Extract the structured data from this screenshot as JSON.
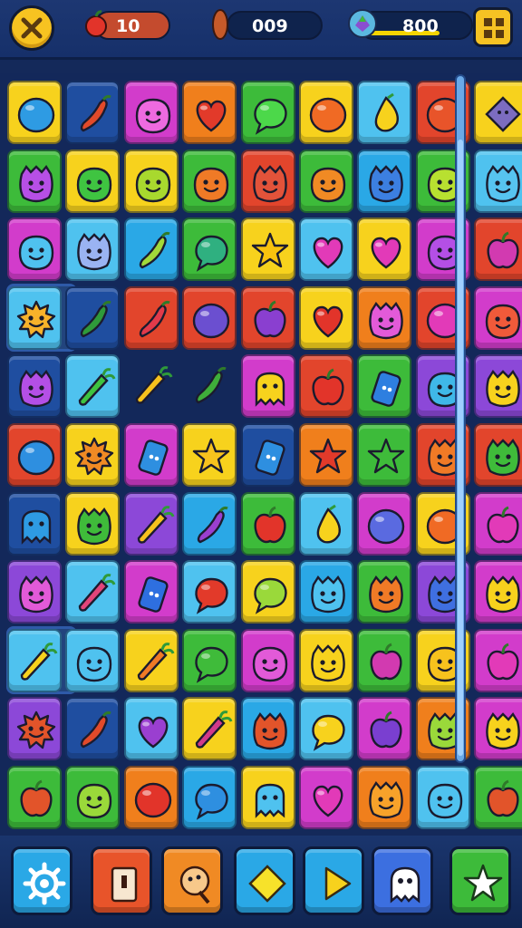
{
  "hud": {
    "moves_value": "10",
    "coins_value": "009",
    "score_value": "800",
    "score_progress": 0.72,
    "moves_icon": "apple-icon",
    "coins_icon": "bean-icon",
    "score_icon": "gem-icon",
    "close_icon": "close-icon",
    "menu_icon": "grid-menu-icon"
  },
  "palette": {
    "yellow": "#f7d21d",
    "blue": "#2aa8e6",
    "magenta": "#d23ccb",
    "orange": "#f07f1c",
    "green": "#3dbb3a",
    "red": "#e2452c",
    "purple": "#8c48d8",
    "lightblue": "#4fc2ef",
    "darkblue": "#1f4ea0"
  },
  "board": {
    "rows": [
      [
        {
          "bg": "yellow",
          "icon": "blob",
          "c": "#2e9be3"
        },
        {
          "bg": "darkblue",
          "icon": "chili",
          "c": "#e24a2a"
        },
        {
          "bg": "magenta",
          "icon": "face",
          "c": "#ee6ae0"
        },
        {
          "bg": "orange",
          "icon": "heart",
          "c": "#e23a2a"
        },
        {
          "bg": "green",
          "icon": "bubble",
          "c": "#4cd84a"
        },
        {
          "bg": "yellow",
          "icon": "blob",
          "c": "#f06a24"
        },
        {
          "bg": "lightblue",
          "icon": "drop",
          "c": "#f7d21d"
        },
        {
          "bg": "red",
          "icon": "blob",
          "c": "#e8542a"
        },
        {
          "bg": "yellow",
          "icon": "diamond",
          "c": "#7c6cc0"
        }
      ],
      [
        {
          "bg": "green",
          "icon": "monster",
          "c": "#b74fe6"
        },
        {
          "bg": "yellow",
          "icon": "face",
          "c": "#3fc441"
        },
        {
          "bg": "yellow",
          "icon": "face",
          "c": "#a8d92e"
        },
        {
          "bg": "green",
          "icon": "face",
          "c": "#f07a26"
        },
        {
          "bg": "red",
          "icon": "monster",
          "c": "#e2533a"
        },
        {
          "bg": "green",
          "icon": "face",
          "c": "#f08a24"
        },
        {
          "bg": "blue",
          "icon": "monster",
          "c": "#3c7fe0"
        },
        {
          "bg": "green",
          "icon": "face",
          "c": "#b8e030"
        },
        {
          "bg": "lightblue",
          "icon": "monster",
          "c": "#57c4f0"
        }
      ],
      [
        {
          "bg": "magenta",
          "icon": "face",
          "c": "#4fc2ef"
        },
        {
          "bg": "lightblue",
          "icon": "monster",
          "c": "#9ab3f2"
        },
        {
          "bg": "blue",
          "icon": "chili",
          "c": "#a2d93a"
        },
        {
          "bg": "green",
          "icon": "bubble",
          "c": "#2fb080"
        },
        {
          "bg": "yellow",
          "icon": "star",
          "c": "#f8c20e"
        },
        {
          "bg": "lightblue",
          "icon": "heart",
          "c": "#e23ab8"
        },
        {
          "bg": "yellow",
          "icon": "heart",
          "c": "#e23ab8"
        },
        {
          "bg": "magenta",
          "icon": "face",
          "c": "#b44fe6"
        },
        {
          "bg": "red",
          "icon": "apple",
          "c": "#d23ab0"
        }
      ],
      [
        {
          "bg": "lightblue",
          "icon": "sun",
          "c": "#f7b22a",
          "selected": true
        },
        {
          "bg": "darkblue",
          "icon": "chili",
          "c": "#2f9a3a"
        },
        {
          "bg": "red",
          "icon": "chili",
          "c": "#e23a4a"
        },
        {
          "bg": "red",
          "icon": "blob",
          "c": "#6b4fd0"
        },
        {
          "bg": "red",
          "icon": "apple",
          "c": "#8a3fd0"
        },
        {
          "bg": "yellow",
          "icon": "heart",
          "c": "#e2342a"
        },
        {
          "bg": "orange",
          "icon": "monster",
          "c": "#e25ad8"
        },
        {
          "bg": "red",
          "icon": "blob",
          "c": "#e23ab8"
        },
        {
          "bg": "magenta",
          "icon": "face",
          "c": "#f05a3a"
        }
      ],
      [
        {
          "bg": "darkblue",
          "icon": "monster",
          "c": "#b44fe6"
        },
        {
          "bg": "lightblue",
          "icon": "carrot",
          "c": "#3fc441"
        },
        {
          "bg": "empty",
          "icon": "carrot",
          "c": "#f7c21d"
        },
        {
          "bg": "empty",
          "icon": "chili",
          "c": "#3fae3a"
        },
        {
          "bg": "magenta",
          "icon": "ghost",
          "c": "#f7d21d"
        },
        {
          "bg": "red",
          "icon": "apple",
          "c": "#e2342a"
        },
        {
          "bg": "green",
          "icon": "phone",
          "c": "#2e7fe0"
        },
        {
          "bg": "purple",
          "icon": "face",
          "c": "#3fb8e8"
        },
        {
          "bg": "purple",
          "icon": "monster",
          "c": "#f7d21d"
        }
      ],
      [
        {
          "bg": "red",
          "icon": "blob",
          "c": "#2e8fe0"
        },
        {
          "bg": "yellow",
          "icon": "sun",
          "c": "#f08a24"
        },
        {
          "bg": "magenta",
          "icon": "phone",
          "c": "#2e8fe0"
        },
        {
          "bg": "yellow",
          "icon": "star",
          "c": "#f7c21d"
        },
        {
          "bg": "darkblue",
          "icon": "phone",
          "c": "#2e8fe0"
        },
        {
          "bg": "orange",
          "icon": "star",
          "c": "#e23a2a"
        },
        {
          "bg": "green",
          "icon": "star",
          "c": "#3fbb3a"
        },
        {
          "bg": "red",
          "icon": "monster",
          "c": "#f07a26"
        },
        {
          "bg": "red",
          "icon": "monster",
          "c": "#3fbb3a"
        }
      ],
      [
        {
          "bg": "darkblue",
          "icon": "ghost",
          "c": "#2e9be3"
        },
        {
          "bg": "yellow",
          "icon": "monster",
          "c": "#3fbb3a"
        },
        {
          "bg": "purple",
          "icon": "carrot",
          "c": "#f7c21d"
        },
        {
          "bg": "blue",
          "icon": "chili",
          "c": "#9a3fd0"
        },
        {
          "bg": "green",
          "icon": "apple",
          "c": "#e2342a"
        },
        {
          "bg": "lightblue",
          "icon": "drop",
          "c": "#f7d21d"
        },
        {
          "bg": "magenta",
          "icon": "blob",
          "c": "#5a6ae0"
        },
        {
          "bg": "yellow",
          "icon": "blob",
          "c": "#f06a24"
        },
        {
          "bg": "magenta",
          "icon": "apple",
          "c": "#e23ab8"
        }
      ],
      [
        {
          "bg": "purple",
          "icon": "monster",
          "c": "#e25ad8"
        },
        {
          "bg": "lightblue",
          "icon": "carrot",
          "c": "#e2457a"
        },
        {
          "bg": "magenta",
          "icon": "phone",
          "c": "#2e6fe0"
        },
        {
          "bg": "lightblue",
          "icon": "bubble",
          "c": "#e23a2a"
        },
        {
          "bg": "yellow",
          "icon": "bubble",
          "c": "#9ad93a"
        },
        {
          "bg": "blue",
          "icon": "monster",
          "c": "#4fc2ef"
        },
        {
          "bg": "green",
          "icon": "monster",
          "c": "#f07a26"
        },
        {
          "bg": "purple",
          "icon": "monster",
          "c": "#3f6fe0"
        },
        {
          "bg": "magenta",
          "icon": "monster",
          "c": "#f7d21d"
        }
      ],
      [
        {
          "bg": "lightblue",
          "icon": "carrot",
          "c": "#f7d21d",
          "selected": true
        },
        {
          "bg": "lightblue",
          "icon": "face",
          "c": "#4fc2ef"
        },
        {
          "bg": "yellow",
          "icon": "carrot",
          "c": "#f07a26"
        },
        {
          "bg": "green",
          "icon": "bubble",
          "c": "#3fbb3a"
        },
        {
          "bg": "magenta",
          "icon": "face",
          "c": "#e25ad8"
        },
        {
          "bg": "yellow",
          "icon": "monster",
          "c": "#f7d21d"
        },
        {
          "bg": "green",
          "icon": "apple",
          "c": "#d23ab0"
        },
        {
          "bg": "yellow",
          "icon": "face",
          "c": "#f7c21d"
        },
        {
          "bg": "magenta",
          "icon": "apple",
          "c": "#e23ab8"
        }
      ],
      [
        {
          "bg": "purple",
          "icon": "sun",
          "c": "#e2542a"
        },
        {
          "bg": "darkblue",
          "icon": "chili",
          "c": "#e24a2a"
        },
        {
          "bg": "lightblue",
          "icon": "heart",
          "c": "#9a3fd0"
        },
        {
          "bg": "yellow",
          "icon": "carrot",
          "c": "#d23a8a"
        },
        {
          "bg": "blue",
          "icon": "monster",
          "c": "#e2542a"
        },
        {
          "bg": "lightblue",
          "icon": "bubble",
          "c": "#f7d21d"
        },
        {
          "bg": "magenta",
          "icon": "apple",
          "c": "#7a3fd0"
        },
        {
          "bg": "orange",
          "icon": "monster",
          "c": "#9ad93a"
        },
        {
          "bg": "magenta",
          "icon": "monster",
          "c": "#f7d21d"
        }
      ],
      [
        {
          "bg": "green",
          "icon": "apple",
          "c": "#e2542a"
        },
        {
          "bg": "green",
          "icon": "face",
          "c": "#9ad93a"
        },
        {
          "bg": "orange",
          "icon": "blob",
          "c": "#e2342a"
        },
        {
          "bg": "blue",
          "icon": "bubble",
          "c": "#2e8fe0"
        },
        {
          "bg": "yellow",
          "icon": "ghost",
          "c": "#4fc2ef"
        },
        {
          "bg": "magenta",
          "icon": "heart",
          "c": "#e23ab8"
        },
        {
          "bg": "orange",
          "icon": "monster",
          "c": "#f7a22a"
        },
        {
          "bg": "lightblue",
          "icon": "face",
          "c": "#4fc2ef"
        },
        {
          "bg": "green",
          "icon": "apple",
          "c": "#e2542a"
        }
      ]
    ]
  },
  "actions": [
    {
      "name": "settings-button",
      "icon": "gear-icon",
      "bg": "#2aa8e6"
    },
    {
      "name": "exit-button",
      "icon": "door-icon",
      "bg": "#e8542a"
    },
    {
      "name": "booster-button",
      "icon": "lollipop-icon",
      "bg": "#f08a24"
    },
    {
      "name": "shuffle-button",
      "icon": "diamond-icon",
      "bg": "#2aa8e6"
    },
    {
      "name": "play-button",
      "icon": "play-icon",
      "bg": "#2aa8e6"
    },
    {
      "name": "ghost-button",
      "icon": "ghost-icon",
      "bg": "#3c6fe0"
    },
    {
      "name": "star-button",
      "icon": "star-icon",
      "bg": "#3dbb3a"
    }
  ]
}
